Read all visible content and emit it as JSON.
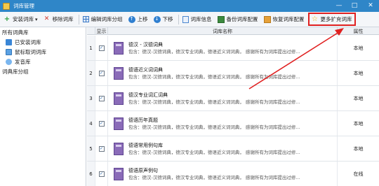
{
  "window": {
    "title": "词库管理",
    "minimize": "—",
    "maximize": "□",
    "close": "✕"
  },
  "toolbar": {
    "install": "安装词库",
    "install_dropdown": "▾",
    "remove": "移除词库",
    "edit_group": "编辑词库分组",
    "move_up": "上移",
    "move_down": "下移",
    "info": "词库信息",
    "backup": "备份词库配置",
    "restore": "恢复词库配置",
    "more": "更多扩充词库"
  },
  "sidebar": {
    "all": "所有词典库",
    "installed": "已安装词库",
    "mouse": "鼠标取词词库",
    "voice": "发音库",
    "groups": "词典库分组"
  },
  "table": {
    "headers": {
      "show": "显示",
      "name": "词库名称",
      "attr": "属性"
    },
    "rows": [
      {
        "num": "1",
        "title": "德汉 - 汉德词典",
        "desc": "包含：德汉-汉德词典，德汉专业词典，德语近义词词典，  感谢所有为词库提出过修...",
        "attr": "本地"
      },
      {
        "num": "2",
        "title": "德语近义词词典",
        "desc": "包含：德汉-汉德词典，德汉专业词典，德语近义词词典，  感谢所有为词库提出过修...",
        "attr": "本地"
      },
      {
        "num": "3",
        "title": "德汉专业词汇词典",
        "desc": "包含：德汉-汉德词典，德汉专业词典，德语近义词词典，  感谢所有为词库提出过修...",
        "attr": "本地"
      },
      {
        "num": "4",
        "title": "德语历年真题",
        "desc": "包含：德汉-汉德词典，德汉专业词典，德语近义词词典，  感谢所有为词库提出过修...",
        "attr": "本地"
      },
      {
        "num": "5",
        "title": "德语常用例句库",
        "desc": "包含：德汉-汉德词典，德汉专业词典，德语近义词词典，  感谢所有为词库提出过修...",
        "attr": "本地"
      },
      {
        "num": "6",
        "title": "德语原声例句",
        "desc": "包含：德汉-汉德词典，德汉专业词典，德语近义词词典，  感谢所有为词库提出过修...",
        "attr": "在线"
      }
    ]
  },
  "colors": {
    "titlebar": "#2f86c8",
    "highlight": "#e02020",
    "arrow": "#e02020"
  },
  "icons": {
    "check": "✓"
  }
}
